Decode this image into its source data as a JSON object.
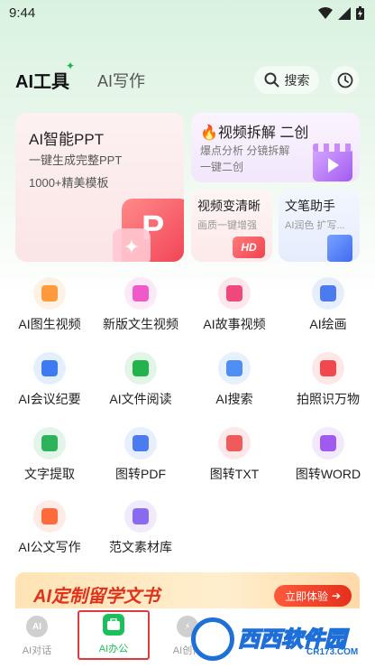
{
  "status_bar": {
    "time": "9:44"
  },
  "header": {
    "tab_tools": "AI工具",
    "tab_write": "AI写作",
    "search_label": "搜索"
  },
  "cards": {
    "ppt": {
      "title": "AI智能PPT",
      "line1": "一键生成完整PPT",
      "line2": "1000+精美模板"
    },
    "video": {
      "title": "视频拆解 二创",
      "sub1": "爆点分析 分镜拆解",
      "sub2": "一键二创"
    },
    "hd": {
      "title": "视频变清晰",
      "sub": "画质一键增强",
      "badge": "HD"
    },
    "copy": {
      "title": "文笔助手",
      "sub": "AI润色 扩写..."
    }
  },
  "tools": [
    {
      "label": "AI图生视频",
      "icon": "video-camera-icon",
      "color": "#ff9a3c"
    },
    {
      "label": "新版文生视频",
      "icon": "video-icon",
      "color": "#f05ac8"
    },
    {
      "label": "AI故事视频",
      "icon": "play-video-icon",
      "color": "#f0487a"
    },
    {
      "label": "AI绘画",
      "icon": "ai-painting-icon",
      "color": "#4a7cf0"
    },
    {
      "label": "AI会议纪要",
      "icon": "meeting-notes-icon",
      "color": "#3d7cf0"
    },
    {
      "label": "AI文件阅读",
      "icon": "file-read-icon",
      "color": "#22b34c"
    },
    {
      "label": "AI搜索",
      "icon": "search-icon",
      "color": "#4d8ff5"
    },
    {
      "label": "拍照识万物",
      "icon": "camera-recognize-icon",
      "color": "#f0484e"
    },
    {
      "label": "文字提取",
      "icon": "text-extract-icon",
      "color": "#2fb35a"
    },
    {
      "label": "图转PDF",
      "icon": "image-to-pdf-icon",
      "color": "#4a7cf0"
    },
    {
      "label": "图转TXT",
      "icon": "image-to-txt-icon",
      "color": "#f05a5a"
    },
    {
      "label": "图转WORD",
      "icon": "image-to-word-icon",
      "color": "#a05af0"
    },
    {
      "label": "AI公文写作",
      "icon": "official-doc-icon",
      "color": "#ff6a3c"
    },
    {
      "label": "范文素材库",
      "icon": "template-library-icon",
      "color": "#8a6af0"
    }
  ],
  "banner": {
    "text": "AI定制留学文书",
    "button": "立即体验"
  },
  "bottom_nav": [
    {
      "label": "AI对话",
      "icon_text": "AI"
    },
    {
      "label": "AI办公",
      "icon_text": ""
    },
    {
      "label": "AI创作",
      "icon_text": ""
    }
  ],
  "watermark": {
    "text": "西西软件园",
    "url": "CR173.COM"
  }
}
